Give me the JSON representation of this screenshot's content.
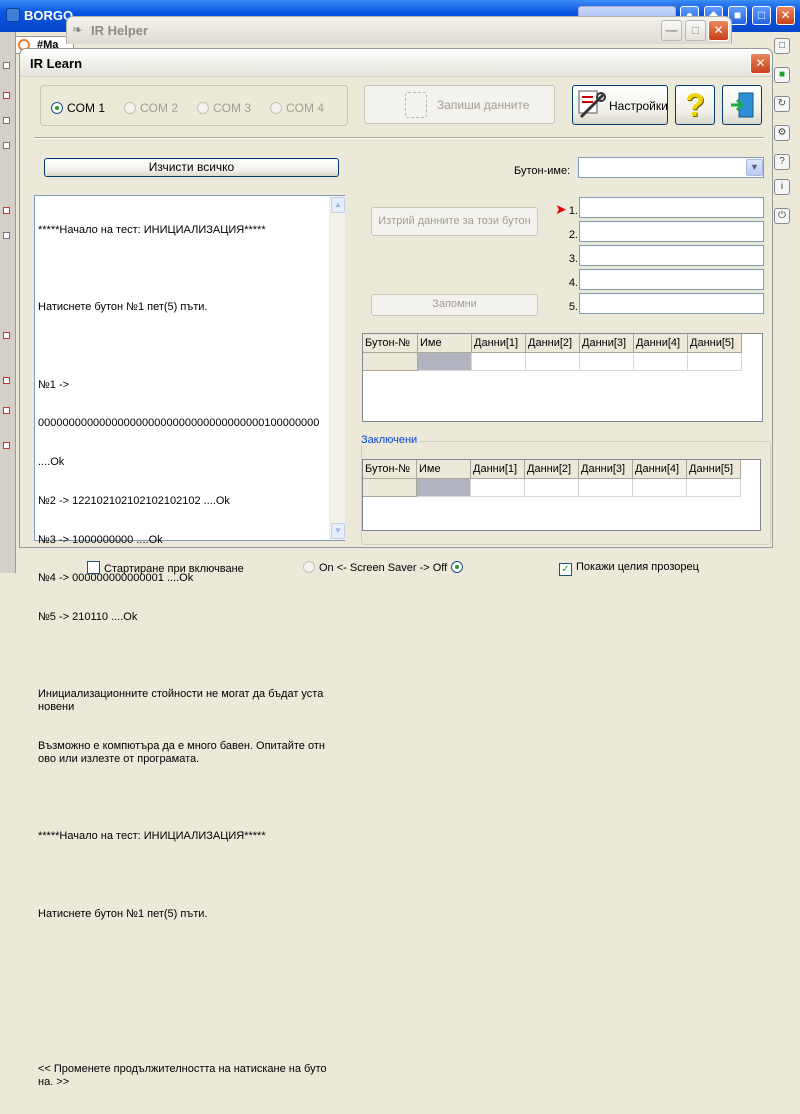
{
  "background_app": {
    "title": "BORGO",
    "tab_label": "#Ma"
  },
  "ir_helper": {
    "title": "IR Helper"
  },
  "dialog": {
    "title": "IR Learn",
    "com_ports": [
      {
        "label": "COM 1",
        "selected": true,
        "enabled": true
      },
      {
        "label": "COM 2",
        "selected": false,
        "enabled": false
      },
      {
        "label": "COM 3",
        "selected": false,
        "enabled": false
      },
      {
        "label": "COM 4",
        "selected": false,
        "enabled": false
      }
    ],
    "save_data_label": "Запиши данните",
    "settings_label": "Настройки",
    "help_icon": "question-mark-icon",
    "exit_icon": "exit-door-icon",
    "clear_all_label": "Изчисти всичко",
    "log_lines": [
      "*****Начало на тест: ИНИЦИАЛИЗАЦИЯ*****",
      "",
      "Натиснете бутон №1 пет(5) пъти.",
      "",
      "№1 ->",
      "0000000000000000000000000000000000000100000000",
      "....Ok",
      "№2 -> 12210210210210210210​2 ....Ok",
      "№3 -> 1000000000 ....Ok",
      "№4 -> 000000000000001 ....Ok",
      "№5 -> 210110 ....Ok",
      "",
      "Инициализационните стойности не могат да бъдат установени",
      "Възможно е компютъра да е много бавен. Опитайте отново или излезте от програмата.",
      "",
      "*****Начало на тест: ИНИЦИАЛИЗАЦИЯ*****",
      "",
      "Натиснете бутон №1 пет(5) пъти.",
      "",
      "",
      "",
      "<< Променете продължителността на натискане на бутона. >>"
    ],
    "button_name_label": "Бутон-име:",
    "button_name_value": "",
    "delete_button_data_label": "Изтрий данните за този бутон",
    "remember_label": "Запомни",
    "data_slots": [
      "1.",
      "2.",
      "3.",
      "4.",
      "5."
    ],
    "active_slot_marker": "➤",
    "grid_columns": [
      "Бутон-№",
      "Име",
      "Данни[1]",
      "Данни[2]",
      "Данни[3]",
      "Данни[4]",
      "Данни[5]"
    ],
    "locked_group_label": "Заключени",
    "locked_grid_columns": [
      "Бутон-№",
      "Име",
      "Данни[1]",
      "Данни[2]",
      "Данни[3]",
      "Данни[4]",
      "Данни[5]"
    ]
  },
  "bottom_bar": {
    "startup_label": "Стартиране при включване",
    "screensaver_label": "On <- Screen Saver -> Off",
    "show_full_window_label": "Покажи целия прозорец"
  },
  "colors": {
    "xp_blue": "#0a54e3",
    "face": "#ece9d8",
    "field_border": "#7f9db9",
    "group_label": "#0046d5",
    "marker_red": "#e00000"
  }
}
